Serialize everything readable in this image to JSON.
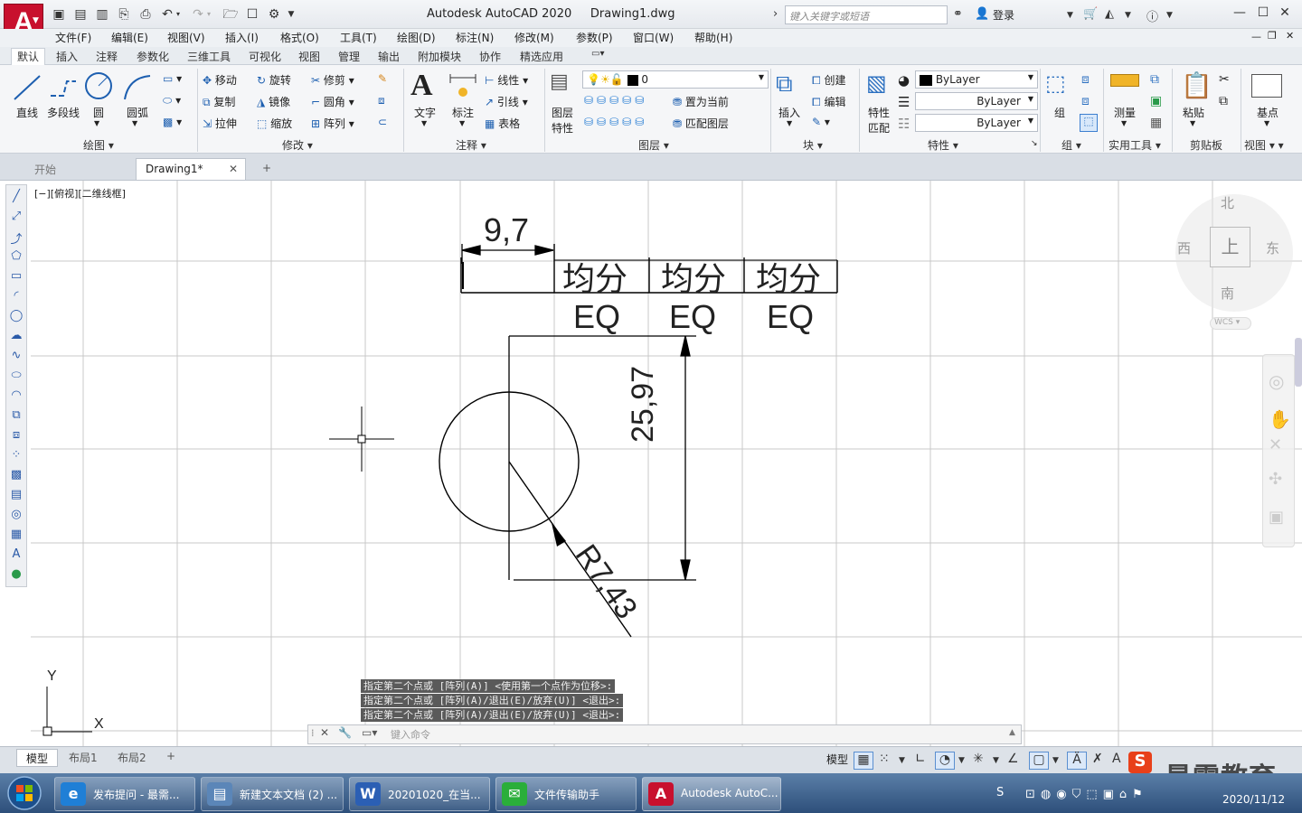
{
  "app": {
    "logo_letter": "A",
    "title": "Autodesk AutoCAD 2020     Drawing1.dwg",
    "search_placeholder": "键入关键字或短语",
    "login": "登录"
  },
  "menu": [
    "文件(F)",
    "编辑(E)",
    "视图(V)",
    "插入(I)",
    "格式(O)",
    "工具(T)",
    "绘图(D)",
    "标注(N)",
    "修改(M)",
    "参数(P)",
    "窗口(W)",
    "帮助(H)"
  ],
  "ribbon_tabs": [
    "默认",
    "插入",
    "注释",
    "参数化",
    "三维工具",
    "可视化",
    "视图",
    "管理",
    "输出",
    "附加模块",
    "协作",
    "精选应用"
  ],
  "ribbon": {
    "draw": {
      "line": "直线",
      "polyline": "多段线",
      "circle": "圆",
      "arc": "圆弧",
      "panel": "绘图"
    },
    "modify": {
      "move": "移动",
      "rotate": "旋转",
      "trim": "修剪",
      "copy": "复制",
      "mirror": "镜像",
      "fillet": "圆角",
      "stretch": "拉伸",
      "scale": "缩放",
      "array": "阵列",
      "panel": "修改"
    },
    "annotation": {
      "text": "文字",
      "dimension": "标注",
      "linear": "线性",
      "leader": "引线",
      "table": "表格",
      "panel": "注释"
    },
    "layers": {
      "layer_props_1": "图层",
      "layer_props_2": "特性",
      "current_layer": "0",
      "make_current": "置为当前",
      "match_layer": "匹配图层",
      "panel": "图层"
    },
    "block": {
      "insert": "插入",
      "create": "创建",
      "edit": "编辑",
      "panel": "块"
    },
    "properties": {
      "match_1": "特性",
      "match_2": "匹配",
      "color": "ByLayer",
      "linetype": "ByLayer",
      "lineweight": "ByLayer",
      "panel": "特性"
    },
    "groups": {
      "group": "组",
      "panel": "组"
    },
    "utilities": {
      "measure": "测量",
      "panel": "实用工具"
    },
    "clipboard": {
      "paste": "粘贴",
      "panel": "剪贴板"
    },
    "view": {
      "base": "基点",
      "panel": "视图"
    }
  },
  "doc_tabs": {
    "start": "开始",
    "drawing": "Drawing1*",
    "add": "+"
  },
  "viewport_label": "[−][俯视][二维线框]",
  "drawing": {
    "dim_top": "9,7",
    "table_headers": [
      "均分",
      "均分",
      "均分"
    ],
    "eq_labels": [
      "EQ",
      "EQ",
      "EQ"
    ],
    "dim_vertical": "25,97",
    "dim_radius": "R7,43",
    "ucs_y": "Y",
    "ucs_x": "X"
  },
  "viewcube": {
    "north": "北",
    "south": "南",
    "east": "东",
    "west": "西",
    "top": "上",
    "wcs": "WCS"
  },
  "command_history": [
    "指定第二个点或 [阵列(A)] <使用第一个点作为位移>:",
    "指定第二个点或 [阵列(A)/退出(E)/放弃(U)] <退出>:",
    "指定第二个点或 [阵列(A)/退出(E)/放弃(U)] <退出>:"
  ],
  "command_placeholder": "键入命令",
  "layout_tabs": [
    "模型",
    "布局1",
    "布局2"
  ],
  "status": {
    "model": "模型"
  },
  "taskbar": {
    "items": [
      {
        "label": "发布提问 - 最需...",
        "icon": "ie-icon",
        "color": "#1f7fd6"
      },
      {
        "label": "新建文本文档 (2) ...",
        "icon": "notepad-icon",
        "color": "#5b86b8"
      },
      {
        "label": "20201020_在当...",
        "icon": "word-icon",
        "color": "#2b5fb4"
      },
      {
        "label": "文件传输助手",
        "icon": "wechat-icon",
        "color": "#2aae3a"
      },
      {
        "label": "Autodesk AutoC...",
        "icon": "autocad-icon",
        "color": "#c8102e"
      }
    ],
    "date": "2020/11/12"
  },
  "watermark": "最需教育"
}
